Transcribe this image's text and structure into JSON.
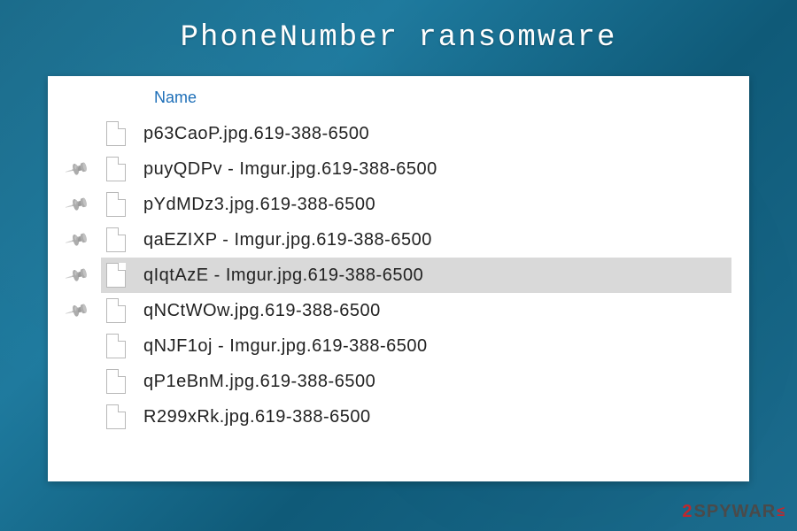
{
  "header": {
    "title": "PhoneNumber ransomware"
  },
  "explorer": {
    "column_header": "Name",
    "files": [
      {
        "name": "p63CaoP.jpg.619-388-6500",
        "pinned": false,
        "selected": false
      },
      {
        "name": "puyQDPv - Imgur.jpg.619-388-6500",
        "pinned": true,
        "selected": false
      },
      {
        "name": "pYdMDz3.jpg.619-388-6500",
        "pinned": true,
        "selected": false
      },
      {
        "name": "qaEZIXP - Imgur.jpg.619-388-6500",
        "pinned": true,
        "selected": false
      },
      {
        "name": "qIqtAzE - Imgur.jpg.619-388-6500",
        "pinned": true,
        "selected": true
      },
      {
        "name": "qNCtWOw.jpg.619-388-6500",
        "pinned": true,
        "selected": false
      },
      {
        "name": "qNJF1oj - Imgur.jpg.619-388-6500",
        "pinned": false,
        "selected": false
      },
      {
        "name": "qP1eBnM.jpg.619-388-6500",
        "pinned": false,
        "selected": false
      },
      {
        "name": "R299xRk.jpg.619-388-6500",
        "pinned": false,
        "selected": false
      }
    ]
  },
  "watermark": {
    "prefix": "2",
    "text": "SPYWAR",
    "suffix": "≤"
  }
}
